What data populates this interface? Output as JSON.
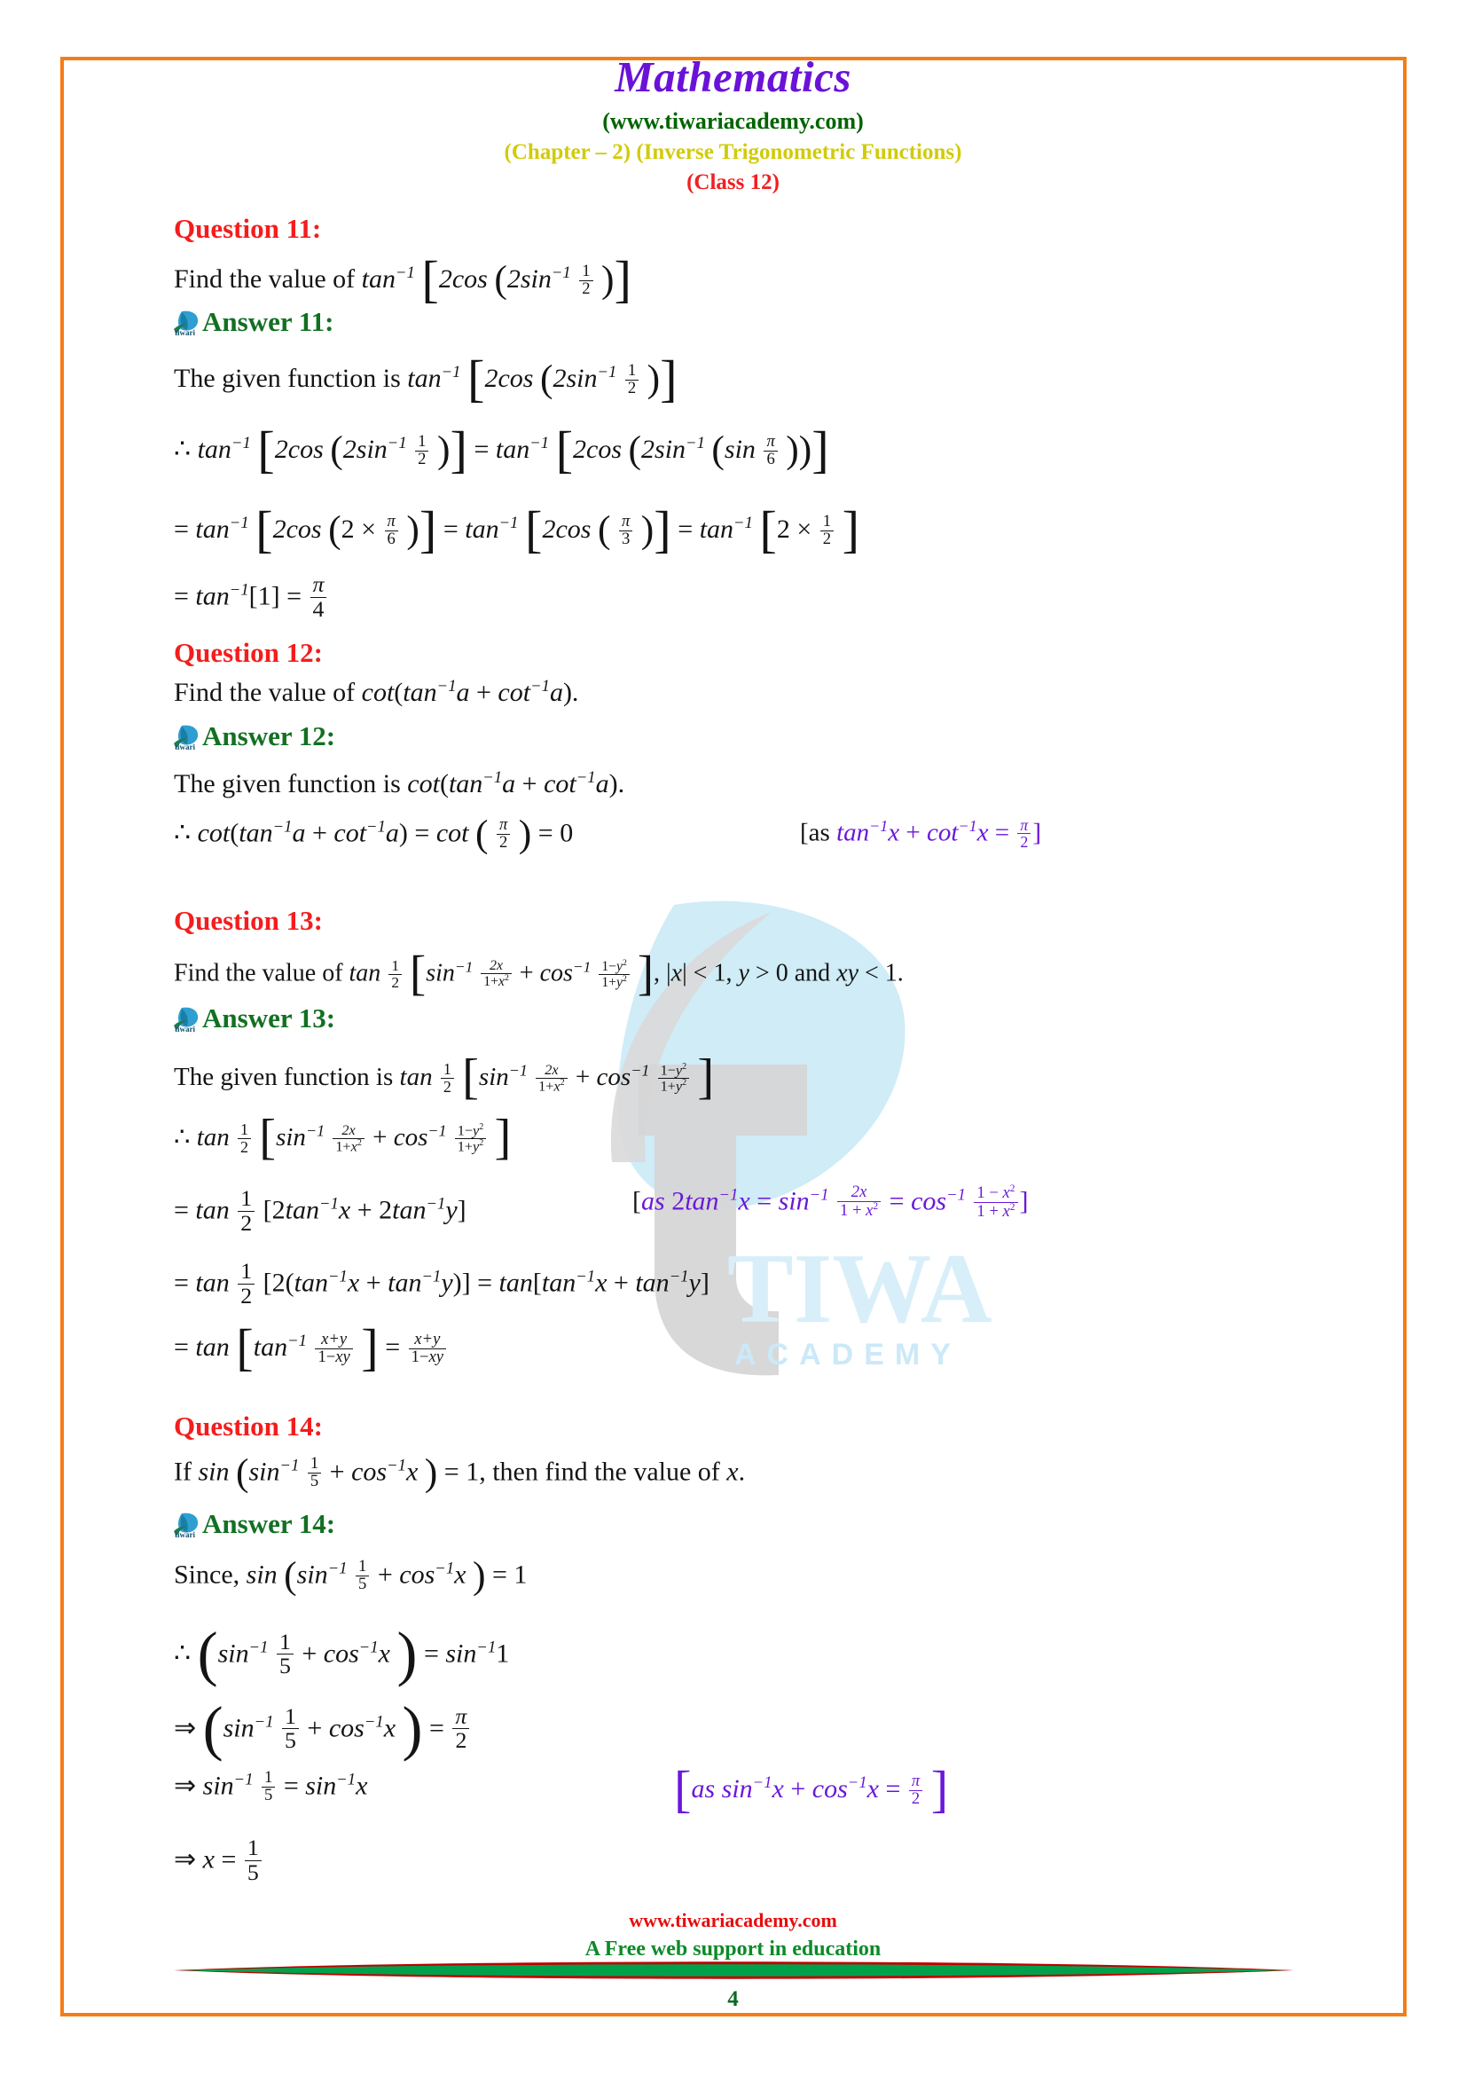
{
  "header": {
    "title": "Mathematics",
    "site": "(www.tiwariacademy.com)",
    "chapter": "(Chapter – 2) (Inverse Trigonometric Functions)",
    "class": "(Class 12)",
    "title_color": "#6A12D8",
    "site_color": "#006400",
    "chapter_color": "#D1CB08",
    "class_color": "#F02020",
    "border_color": "#F57C16"
  },
  "labels": {
    "q11": "Question 11:",
    "a11": "Answer 11:",
    "q12": "Question 12:",
    "a12": "Answer 12:",
    "q13": "Question 13:",
    "a13": "Answer 13:",
    "q14": "Question 14:",
    "a14": "Answer 14:",
    "question_color": "#F41D1D",
    "answer_color": "#127022"
  },
  "q11": {
    "prompt_prefix": "Find the value of",
    "expression": "tan⁻¹[2cos(2sin⁻¹ 1/2)]",
    "answer_intro": "The given function is",
    "step1_lhs": "∴ tan⁻¹[2cos(2sin⁻¹ 1/2)]",
    "step1_rhs": "tan⁻¹[2cos(2sin⁻¹(sin π/6))]",
    "step2_a": "= tan⁻¹[2cos(2 × π/6)]",
    "step2_b": "= tan⁻¹[2cos(π/3)]",
    "step2_c": "= tan⁻¹[2 × 1/2]",
    "step3": "= tan⁻¹[1] = π/4",
    "frac_1_2_num": "1",
    "frac_1_2_den": "2",
    "pi": "π",
    "six": "6",
    "three": "3",
    "four": "4",
    "two": "2",
    "one": "1"
  },
  "q12": {
    "prompt_prefix": "Find the value of",
    "expression": "cot(tan⁻¹a + cot⁻¹a).",
    "answer_intro": "The given function is",
    "answer_expression": "cot(tan⁻¹a + cot⁻¹a).",
    "step1": "∴ cot(tan⁻¹a + cot⁻¹a) = cot(π/2) = 0",
    "note": "[as tan⁻¹x + cot⁻¹x = π/2]",
    "note_color": "#6A18D8",
    "result": "0"
  },
  "q13": {
    "prompt_prefix": "Find the value of",
    "expression": "tan 1/2 [sin⁻¹ 2x/(1+x²) + cos⁻¹ (1−y²)/(1+y²)]",
    "conditions": ", |x| < 1, y > 0 and xy < 1.",
    "answer_intro": "The given function is",
    "step1": "∴ tan 1/2 [sin⁻¹ 2x/(1+x²) + cos⁻¹ (1−y²)/(1+y²)]",
    "step2": "= tan 1/2 [2tan⁻¹x + 2tan⁻¹y]",
    "note": "[as 2tan⁻¹x = sin⁻¹ 2x/(1+x²) = cos⁻¹ (1−x²)/(1+x²)]",
    "step3": "= tan 1/2 [2(tan⁻¹x + tan⁻¹y)] = tan[tan⁻¹x + tan⁻¹y]",
    "step4": "= tan[tan⁻¹ (x+y)/(1−xy)] = (x+y)/(1−xy)",
    "note_color": "#6A18D8"
  },
  "q14": {
    "prompt": "If sin(sin⁻¹ 1/5 + cos⁻¹x) = 1, then find the value of x.",
    "answer_intro": "Since,",
    "step0": "sin(sin⁻¹ 1/5 + cos⁻¹x) = 1",
    "step1": "∴ (sin⁻¹ 1/5 + cos⁻¹x) = sin⁻¹1",
    "step2": "⇒ (sin⁻¹ 1/5 + cos⁻¹x) = π/2",
    "step3": "⇒ sin⁻¹ 1/5 = sin⁻¹x",
    "note": "[as sin⁻¹x + cos⁻¹x = π/2]",
    "step4": "⇒ x = 1/5",
    "note_color": "#6A18D8",
    "five": "5"
  },
  "text": {
    "find_value_of": "Find the value of",
    "given_function_is": "The given function is",
    "since": "Since,",
    "then_find_value": ", then find the value of ",
    "and": " and ",
    "if": "If"
  },
  "footer": {
    "site": "www.tiwariacademy.com",
    "tagline": "A Free web support in education",
    "page_number": "4",
    "site_color": "#E80C0C",
    "tagline_color": "#0C8A28",
    "divider_red": "#C00000",
    "divider_green": "#00A14B"
  },
  "watermark": {
    "brand": "TIWARI",
    "sub": "ACADEMY",
    "color": "#CFEAF7"
  }
}
